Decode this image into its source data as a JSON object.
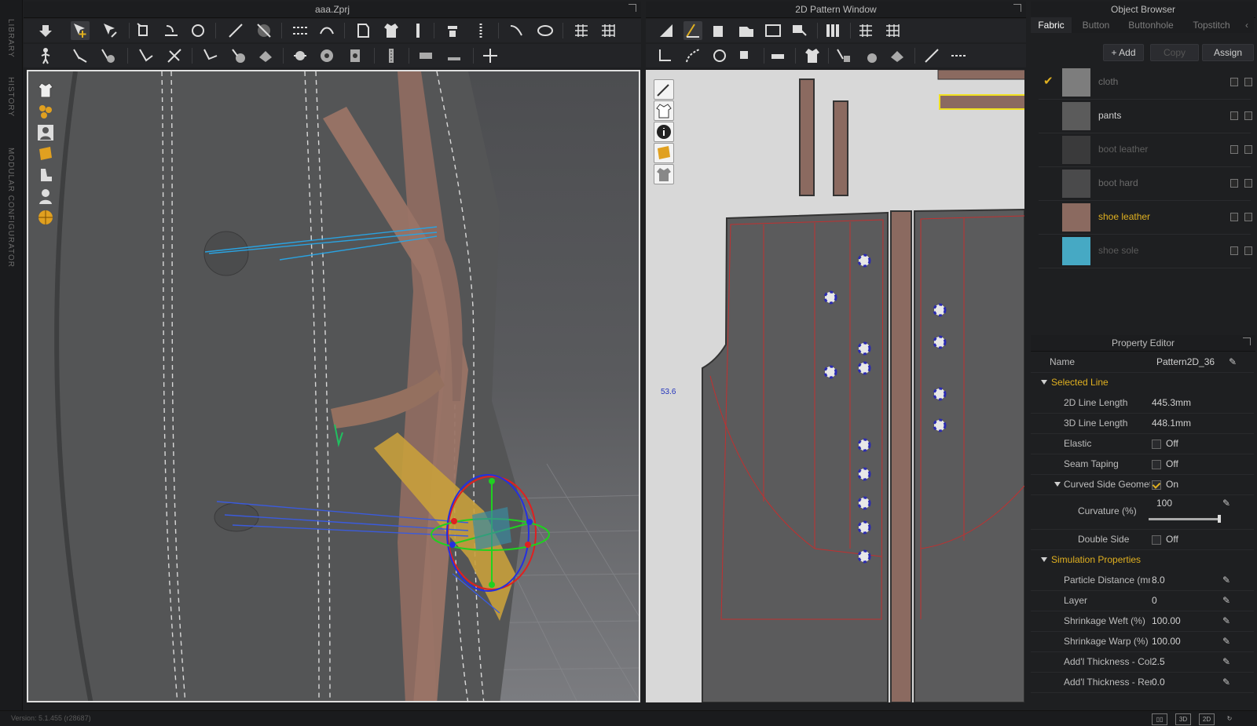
{
  "app": {
    "version": "Version: 5.1.455 (r28687)"
  },
  "rail": {
    "library": "LIBRARY",
    "history": "HISTORY",
    "modular": "MODULAR CONFIGURATOR"
  },
  "panels": {
    "view3d_title": "aaa.Zprj",
    "view2d_title": "2D Pattern Window",
    "object_browser_title": "Object Browser",
    "property_editor_title": "Property Editor"
  },
  "view2d": {
    "dimension_label": "53.6"
  },
  "object_browser": {
    "tabs": [
      "Fabric",
      "Button",
      "Buttonhole",
      "Topstitch"
    ],
    "buttons": {
      "add": "+ Add",
      "copy": "Copy",
      "assign": "Assign"
    },
    "fabrics": [
      {
        "name": "cloth",
        "color": "#7d7d7d",
        "text_color": "#6f6f6f",
        "selected": true
      },
      {
        "name": "pants",
        "color": "#5b5b5b",
        "text_color": "#d0d0d0",
        "selected": false
      },
      {
        "name": "boot leather",
        "color": "#3a3a3b",
        "text_color": "#5f5f5f",
        "selected": false
      },
      {
        "name": "boot hard",
        "color": "#4a4a4b",
        "text_color": "#6a6a6a",
        "selected": false
      },
      {
        "name": "shoe leather",
        "color": "#8b6a60",
        "text_color": "#e0b020",
        "selected": false
      },
      {
        "name": "shoe sole",
        "color": "#46a9c4",
        "text_color": "#5a5a5a",
        "selected": false
      }
    ]
  },
  "property_editor": {
    "name_label": "Name",
    "name_value": "Pattern2D_36",
    "selected_line": {
      "title": "Selected Line",
      "line_2d_label": "2D Line Length",
      "line_2d_value": "445.3mm",
      "line_3d_label": "3D Line Length",
      "line_3d_value": "448.1mm",
      "elastic_label": "Elastic",
      "elastic_value": "Off",
      "seam_taping_label": "Seam Taping",
      "seam_taping_value": "Off",
      "curved_label": "Curved Side Geometry",
      "curved_value": "On",
      "curvature_label": "Curvature (%)",
      "curvature_value": "100",
      "double_side_label": "Double Side",
      "double_side_value": "Off"
    },
    "simulation": {
      "title": "Simulation Properties",
      "particle_label": "Particle Distance (mm)",
      "particle_value": "8.0",
      "layer_label": "Layer",
      "layer_value": "0",
      "weft_label": "Shrinkage Weft (%)",
      "weft_value": "100.00",
      "warp_label": "Shrinkage Warp (%)",
      "warp_value": "100.00",
      "coll_label": "Add'l Thickness - Collision",
      "coll_value": "2.5",
      "ren_label": "Add'l Thickness - Rendering",
      "ren_value": "0.0"
    }
  },
  "colors": {
    "accent": "#e0b020",
    "pattern_fill": "#5b5b5c",
    "strap": "#8b6a60"
  }
}
